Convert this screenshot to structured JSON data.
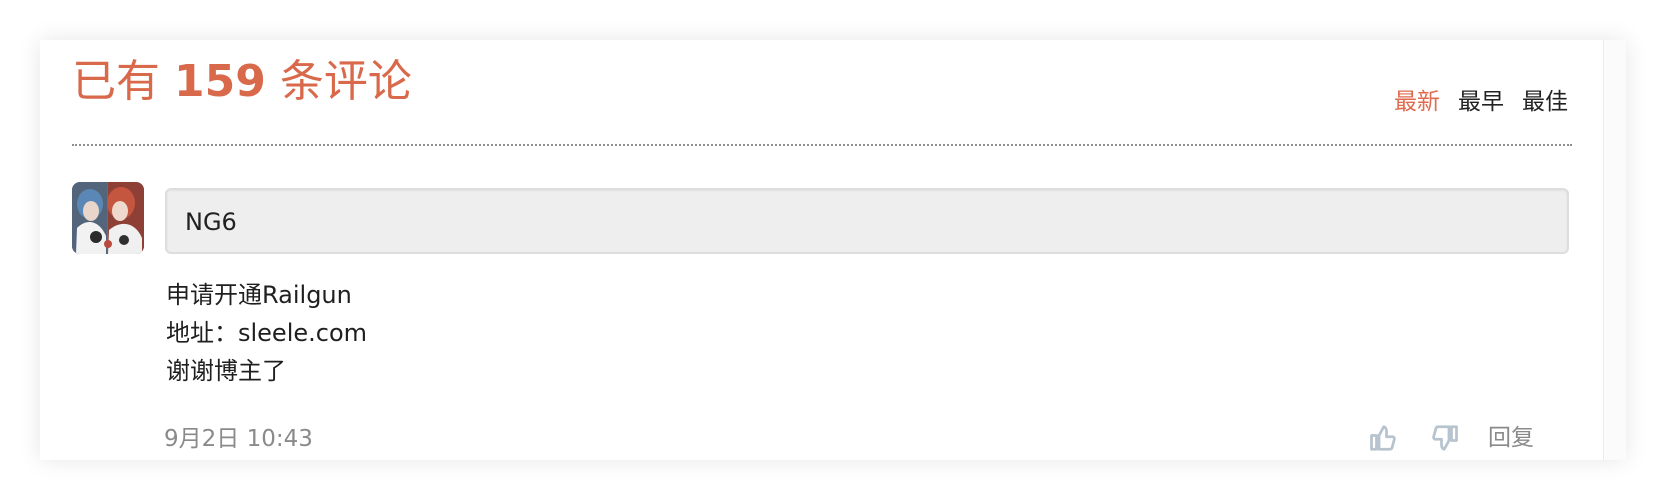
{
  "comments_header": {
    "title_prefix": "已有",
    "count": "159",
    "title_suffix": "条评论"
  },
  "sort_tabs": [
    {
      "label": "最新",
      "active": true
    },
    {
      "label": "最早",
      "active": false
    },
    {
      "label": "最佳",
      "active": false
    }
  ],
  "comment": {
    "author": "NG6",
    "body": [
      "申请开通Railgun",
      "地址：sleele.com",
      "谢谢博主了"
    ],
    "timestamp": "9月2日 10:43",
    "reply_label": "回复"
  },
  "icons": {
    "like": "thumbs-up-icon",
    "dislike": "thumbs-down-icon"
  },
  "colors": {
    "accent": "#d9694b",
    "active_tab": "#e06b4e",
    "muted_text": "#8a8a8a",
    "icon": "#b7c4d0"
  }
}
